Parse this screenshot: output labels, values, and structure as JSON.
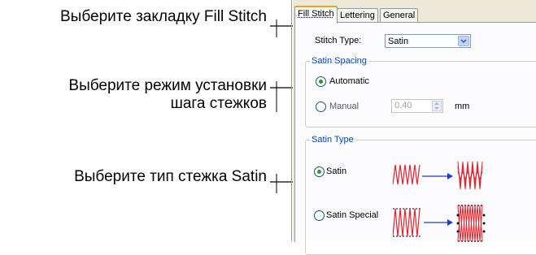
{
  "callouts": {
    "select_tab": "Выберите закладку Fill Stitch",
    "select_spacing_line1": "Выберите режим установки",
    "select_spacing_line2": "шага стежков",
    "select_satin": "Выберите тип стежка Satin"
  },
  "tabs": [
    {
      "label": "Fill Stitch",
      "active": true
    },
    {
      "label": "Lettering",
      "active": false
    },
    {
      "label": "General",
      "active": false
    }
  ],
  "stitch_type": {
    "label": "Stitch Type:",
    "value": "Satin"
  },
  "satin_spacing": {
    "title": "Satin Spacing",
    "automatic_label": "Automatic",
    "manual_label": "Manual",
    "manual_value": "0.40",
    "unit": "mm",
    "selected": "automatic"
  },
  "satin_type": {
    "title": "Satin Type",
    "satin_label": "Satin",
    "satin_special_label": "Satin Special",
    "selected": "satin"
  },
  "colors": {
    "stitch": "#e8202a",
    "arrow": "#1d3ad6",
    "group_title": "#0046d5"
  }
}
